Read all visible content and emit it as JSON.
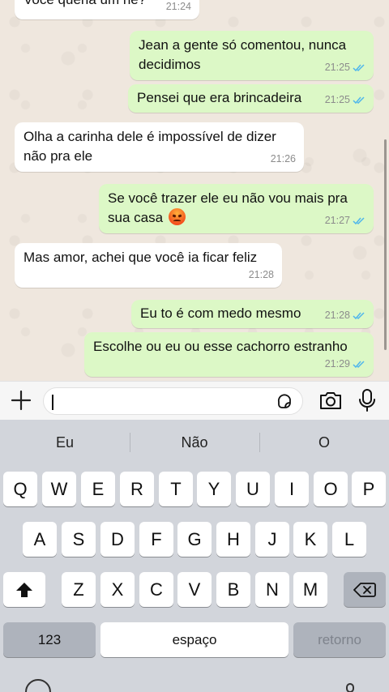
{
  "chat": {
    "messages": [
      {
        "dir": "in",
        "text": "Você queria um né?",
        "time": "21:24"
      },
      {
        "dir": "out",
        "text": "Jean a gente só comentou, nunca\ndecidimos",
        "time": "21:25"
      },
      {
        "dir": "out",
        "text": "Pensei que era brincadeira",
        "time": "21:25"
      },
      {
        "dir": "in",
        "text": "Olha a carinha dele é impossível de dizer\nnão pra ele",
        "time": "21:26"
      },
      {
        "dir": "out",
        "text": "Se você trazer ele eu não vou mais pra\nsua casa",
        "time": "21:27"
      },
      {
        "dir": "in",
        "text": "Mas amor, achei que você ia ficar feliz",
        "time": "21:28"
      },
      {
        "dir": "out",
        "text": "Eu to é com medo mesmo",
        "time": "21:28"
      },
      {
        "dir": "out",
        "text": "Escolhe ou eu ou esse cachorro estranho",
        "time": "21:29"
      }
    ],
    "emoji_after_message_5": "angry-face",
    "colors": {
      "outgoing_bubble": "#dcf8c6",
      "incoming_bubble": "#ffffff",
      "read_ticks": "#4fb6ec"
    }
  },
  "input_bar": {
    "plus_icon": "plus-icon",
    "sticker_icon": "sticker-icon",
    "camera_icon": "camera-icon",
    "mic_icon": "microphone-icon"
  },
  "keyboard": {
    "suggestions": [
      "Eu",
      "Não",
      "O"
    ],
    "row1": [
      "Q",
      "W",
      "E",
      "R",
      "T",
      "Y",
      "U",
      "I",
      "O",
      "P"
    ],
    "row2": [
      "A",
      "S",
      "D",
      "F",
      "G",
      "H",
      "J",
      "K",
      "L"
    ],
    "row3": [
      "Z",
      "X",
      "C",
      "V",
      "B",
      "N",
      "M"
    ],
    "numbers_label": "123",
    "space_label": "espaço",
    "return_label": "retorno"
  }
}
